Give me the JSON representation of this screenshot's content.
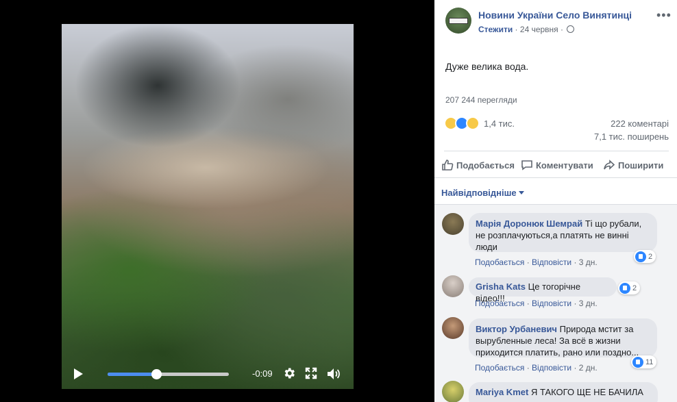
{
  "video": {
    "time_remaining": "-0:09",
    "progress": 0.4,
    "icons": [
      "play-icon",
      "settings-gear-icon",
      "fullscreen-icon",
      "volume-icon"
    ]
  },
  "post": {
    "page_name": "Новини України Село Винятинці",
    "follow_label": "Стежити",
    "date": "24 червня",
    "text": "Дуже велика вода.",
    "views": "207 244 перегляди",
    "reactions_count": "1,4 тис.",
    "comments_count": "222 коментарі",
    "shares_count": "7,1 тис. поширень",
    "actions": {
      "like": "Подобається",
      "comment": "Коментувати",
      "share": "Поширити"
    },
    "sort_label": "Найвідповідніше"
  },
  "colors": {
    "link_blue": "#385898",
    "like_blue": "#2d86ff",
    "progress_blue": "#4c8df0"
  },
  "comments": [
    {
      "author": "Марія Доронюк Шемрай",
      "text": "Ті що рубали, не розплачуються,а платять не винні люди",
      "like": "Подобається",
      "reply": "Відповісти",
      "time": "3 дн.",
      "reactions": "2"
    },
    {
      "author": "Grisha Kats",
      "text": "Це тогорічне відео!!!",
      "like": "Подобається",
      "reply": "Відповісти",
      "time": "3 дн.",
      "reactions": "2"
    },
    {
      "author": "Виктор Урбаневич",
      "text": "Природа мстит за вырубленные леса! За всё в жизни приходится платить, рано или поздно...",
      "like": "Подобається",
      "reply": "Відповісти",
      "time": "2 дн.",
      "reactions": "11"
    },
    {
      "author": "Mariya Kmet",
      "text": "Я ТАКОГО ЩЕ НЕ БАЧИЛА"
    }
  ]
}
